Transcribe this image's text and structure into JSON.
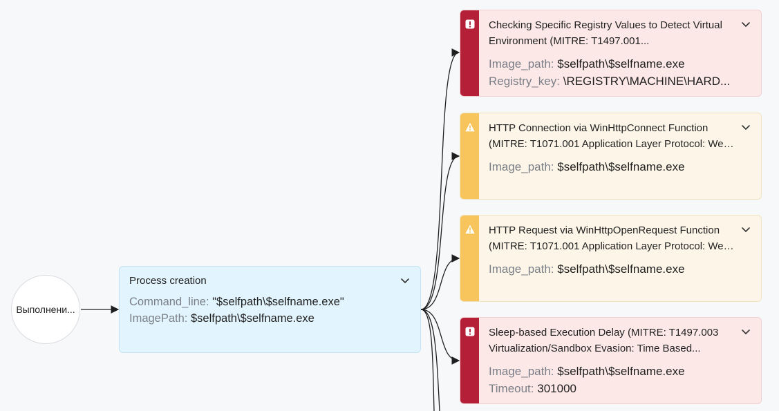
{
  "start_node": {
    "label": "Выполнени..."
  },
  "process_card": {
    "title": "Process creation",
    "fields": [
      {
        "key": "Command_line:",
        "value": "\"$selfpath\\$selfname.exe\""
      },
      {
        "key": "ImagePath:",
        "value": "$selfpath\\$selfname.exe"
      }
    ]
  },
  "detections": [
    {
      "severity": "critical",
      "title_line1": "Checking Specific Registry Values to Detect Virtual",
      "title_line2": "Environment (MITRE: T1497.001...",
      "fields": [
        {
          "key": "Image_path:",
          "value": "$selfpath\\$selfname.exe"
        },
        {
          "key": "Registry_key:",
          "value": "\\REGISTRY\\MACHINE\\HARD..."
        }
      ]
    },
    {
      "severity": "warning",
      "title_line1": "HTTP Connection via WinHttpConnect Function",
      "title_line2": "(MITRE: T1071.001 Application Layer Protocol: Web...",
      "fields": [
        {
          "key": "Image_path:",
          "value": "$selfpath\\$selfname.exe"
        }
      ]
    },
    {
      "severity": "warning",
      "title_line1": "HTTP Request via WinHttpOpenRequest Function",
      "title_line2": "(MITRE: T1071.001 Application Layer Protocol: Web...",
      "fields": [
        {
          "key": "Image_path:",
          "value": "$selfpath\\$selfname.exe"
        }
      ]
    },
    {
      "severity": "critical",
      "title_line1": "Sleep-based Execution Delay (MITRE: T1497.003",
      "title_line2": "Virtualization/Sandbox Evasion: Time Based...",
      "fields": [
        {
          "key": "Image_path:",
          "value": "$selfpath\\$selfname.exe"
        },
        {
          "key": "Timeout:",
          "value": "301000"
        }
      ]
    }
  ],
  "colors": {
    "critical": "#b51f38",
    "warning": "#f7c55c",
    "process": "#e2f4fd",
    "edge": "#1f1f1f"
  },
  "icons": {
    "critical": "exclamation-square-icon",
    "warning": "warning-triangle-icon",
    "expand": "chevron-down-icon"
  }
}
